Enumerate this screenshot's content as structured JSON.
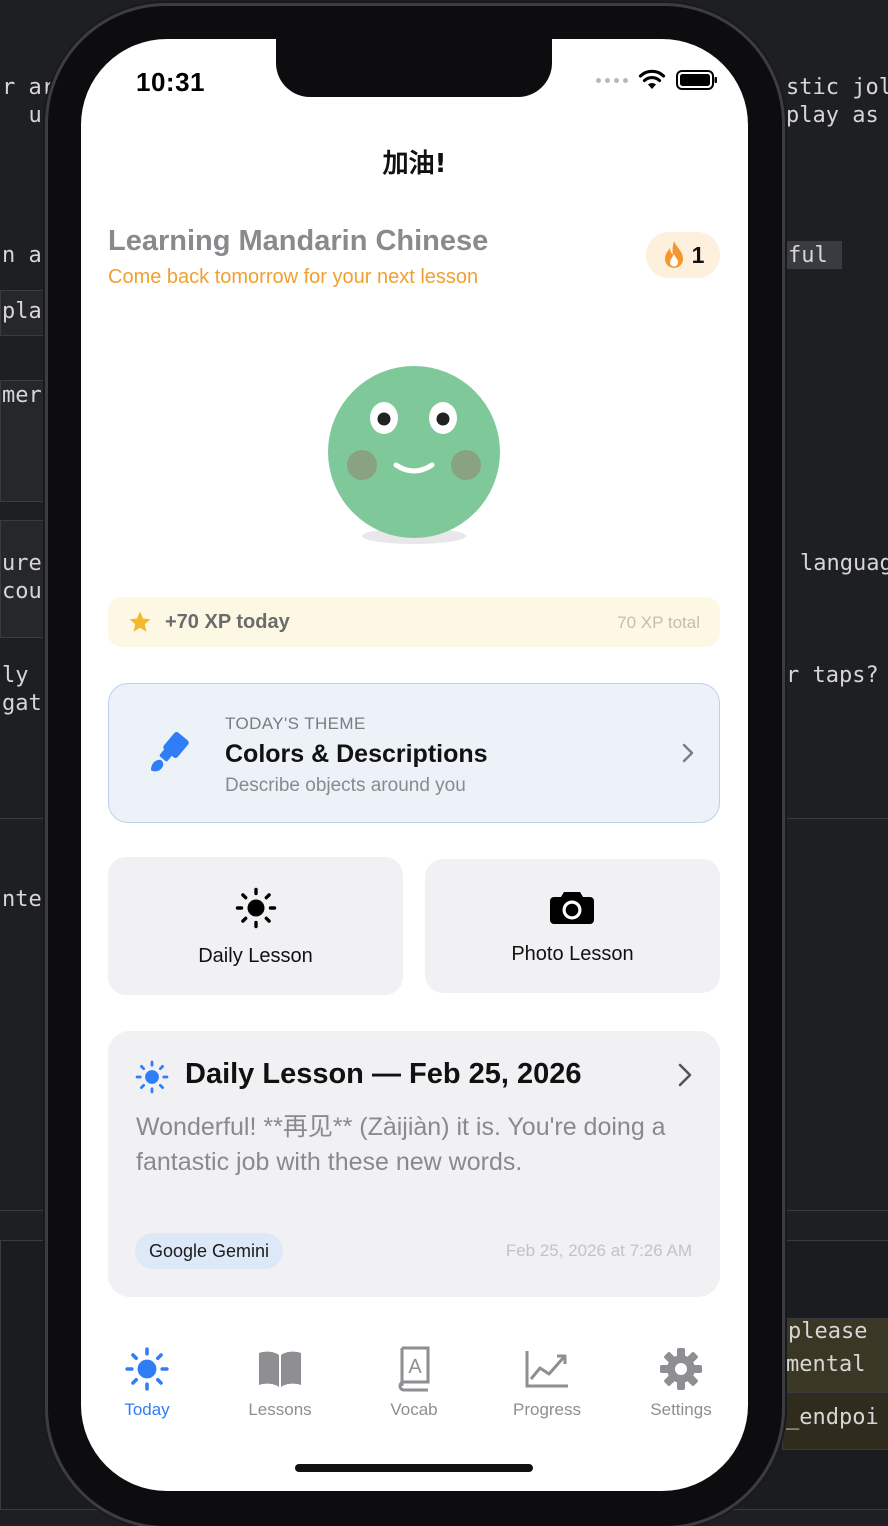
{
  "background": {
    "left_fragments": [
      "r ar",
      "  us",
      "n a",
      "pla",
      "mer",
      "ure",
      "cou",
      "ly",
      "gat",
      "nte"
    ],
    "right_fragments": [
      "stic jol",
      "play as",
      "ful",
      "languag",
      "r taps?",
      "please",
      "mental",
      "_endpoi"
    ]
  },
  "status_bar": {
    "time": "10:31"
  },
  "nav": {
    "title": "加油!"
  },
  "header": {
    "language_title": "Learning Mandarin Chinese",
    "subtitle": "Come back tomorrow for your next lesson",
    "streak_count": "1"
  },
  "xp": {
    "today": "+70 XP today",
    "total": "70 XP total"
  },
  "theme": {
    "kicker": "TODAY'S THEME",
    "title": "Colors & Descriptions",
    "description": "Describe objects around you"
  },
  "actions": {
    "daily_lesson": "Daily Lesson",
    "photo_lesson": "Photo Lesson"
  },
  "daily_card": {
    "title": "Daily Lesson — Feb 25, 2026",
    "text": "Wonderful! **再见** (Zàijiàn) it is. You're doing a fantastic job with these new words.",
    "tag": "Google Gemini",
    "timestamp": "Feb 25, 2026 at 7:26 AM"
  },
  "tabs": [
    {
      "label": "Today",
      "icon": "sun-icon",
      "active": true
    },
    {
      "label": "Lessons",
      "icon": "book-icon",
      "active": false
    },
    {
      "label": "Vocab",
      "icon": "dictionary-icon",
      "active": false
    },
    {
      "label": "Progress",
      "icon": "chart-icon",
      "active": false
    },
    {
      "label": "Settings",
      "icon": "gear-icon",
      "active": false
    }
  ],
  "colors": {
    "accent_blue": "#2f7ef6",
    "streak_bg": "#fdf0dc",
    "subtitle_orange": "#f0a030",
    "mascot_green": "#7ec89a"
  }
}
